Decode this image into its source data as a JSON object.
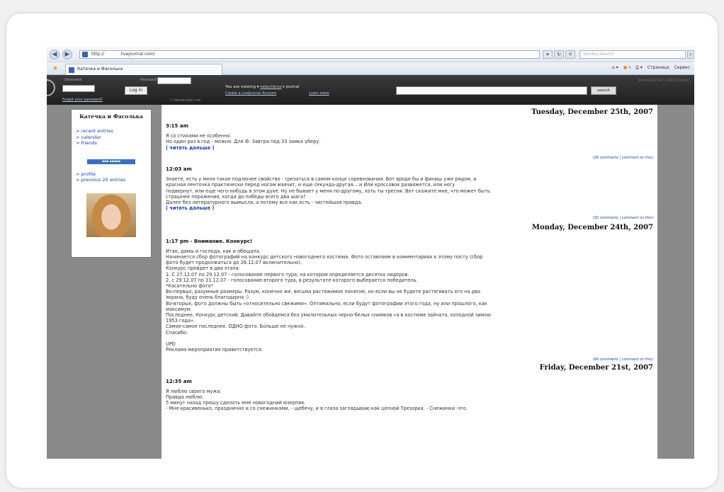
{
  "browser": {
    "url": "http://",
    "url_rest": ".livejournal.com/",
    "tab_title": "Катечка и Фасолька",
    "search_placeholder": "Yandex Search",
    "tools": [
      "Страница",
      "Сервис"
    ]
  },
  "lj_header": {
    "username_label": "Username",
    "password_label": "Password",
    "login_button": "Log in",
    "forgot_link": "Forgot your password?",
    "remember_label": "Remember me",
    "viewing_text": "You are viewing",
    "viewing_user": "katechkina",
    "viewing_suffix": "'s journal",
    "create_link": "Create a LiveJournal Account",
    "learn_link": "Learn more",
    "search_button": "search",
    "powered": "POWERED BY LIVEJOURNAL"
  },
  "sidebar": {
    "title": "Катечка и Фасолька",
    "links": [
      "recent entries",
      "calendar",
      "friends"
    ],
    "links2": [
      "profile",
      "previous 20 entries"
    ]
  },
  "entries": {
    "d1": "Tuesday, December 25th, 2007",
    "e1_time": "3:15 am",
    "e1_l1": "Я со стихами не особенно.",
    "e1_l2": "Но один раз в год - можно. Для Ф. Завтра под 33 замка уберу.",
    "e1_more": "( читать дальше )",
    "e1_comments": "(28 comments | comment on this)",
    "e2_time": "12:03 am",
    "e2_l1": "Знаете, есть у меня такое подлючее свойство - срезаться в самом конце соревнования. Вот вроде бы и финиш уже рядом, и",
    "e2_l2": "красная ленточка практически перед носом маячит, и еще секунда-другая... и          Или кроссовок развяжется, или ногу",
    "e2_l3": "подвернут, или еще чего-нибудь в этом духе. Ну не бывает у меня по-другому, хоть ты тресни. Вот скажите мне, что может быть",
    "e2_l4": "страшнее поражения, когда до победы всего два шага?",
    "e2_l5": "Далее без литературного вымысла, а потому все как есть - чистейшая правда.",
    "e2_more": "( читать дальше )",
    "e2_comments": "(30 comments | comment on this)",
    "d2": "Monday, December 24th, 2007",
    "e3_time": "1:17 pm - Внимание. Конкурс!",
    "e3_l1": "Итак, дамы и господа, как и обещала.",
    "e3_l2": "Начинается сбор фотографий на конкурс детского новогоднего костюма. Фото оставляем в комментариях к этому посту (сбор",
    "e3_l3": "фото будет продолжаться до 26.12.07 включительно).",
    "e3_l4": "Конкурс пройдет в два этапа:",
    "e3_l5": "1. С 27.12.07 по 29.12.07 - голосование первого тура, на котором определяется десятка лидеров.",
    "e3_l6": "2. с 29.12.07 по 31.12.07 - голосование второго тура, в результате которого выберается победитель.",
    "e3_l7": "*Касательно фото*",
    "e3_l8": "Во-первых, разумные размеры. Разум, конечно же, весьма растяжимое понятие, но если вы не будете растягивать его на два",
    "e3_l9": "экрана, буду очень благодарна :)",
    "e3_l10": "Во-вторых, фото должны быть «относительно свежими». Оптимально, если будут фотографии этого года, ну или прошлого, как",
    "e3_l11": "максимум.",
    "e3_l12": "Последнее. Конкурс детский. Давайте обойдемся без умилительных черно-белых снимков «я в костюме зайчата, холодной зимою",
    "e3_l13": "1953 года».",
    "e3_l14": "Самое-самое последнее. ОДНО фото. Больше не нужно.",
    "e3_l15": "Спасибо.",
    "e3_l16": "UPD",
    "e3_l17": "Реклама мероприятия приветствуется.",
    "e3_comments": "(99 comments | comment on this)",
    "d3": "Friday, December 21st, 2007",
    "e4_time": "12:35 am",
    "e4_l1": "Я люблю своего мужа.",
    "e4_l2": "Правда люблю.",
    "e4_l3": "5 минут назад прошу сделать мне новогодний юзерпик.",
    "e4_l4": "- Мне красивенько, празднично и со снежинками, - щебечу, и в глаза заглядываю как цепной Трезорка. - Снежинки -это"
  },
  "colors": {
    "page_bg": "#8a8a8a",
    "link": "#1a3fa8",
    "header_bg": "#2b2b2b"
  }
}
